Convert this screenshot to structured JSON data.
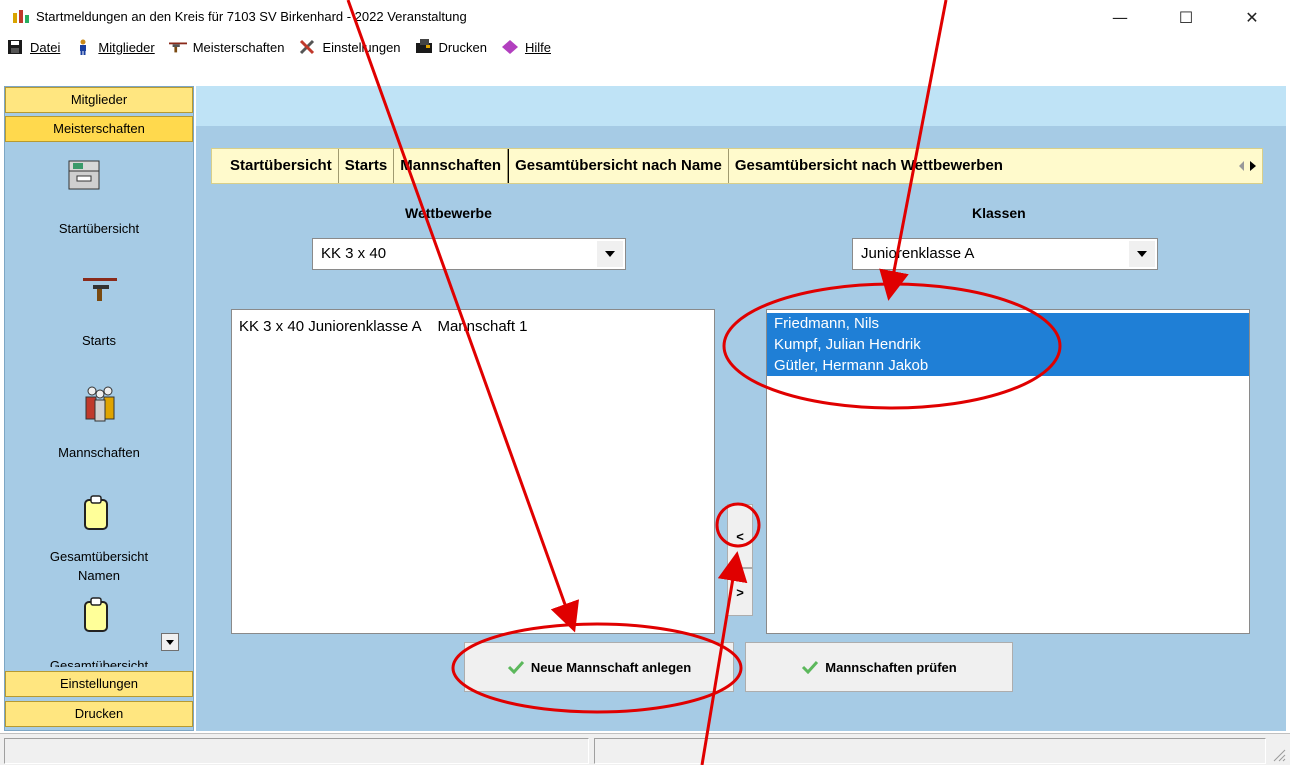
{
  "window": {
    "title": "Startmeldungen an den Kreis für 7103 SV Birkenhard - 2022  Veranstaltung",
    "minimize": "—",
    "maximize": "☐",
    "close": "✕"
  },
  "menu": [
    {
      "label": "Datei",
      "icon": "save-icon"
    },
    {
      "label": "Mitglieder",
      "icon": "member-icon"
    },
    {
      "label": "Meisterschaften",
      "icon": "rifle-icon"
    },
    {
      "label": "Einstellungen",
      "icon": "tools-icon"
    },
    {
      "label": "Drucken",
      "icon": "printer-icon"
    },
    {
      "label": "Hilfe",
      "icon": "help-icon"
    }
  ],
  "sidebar": {
    "headers": {
      "mitglieder": "Mitglieder",
      "meisterschaften": "Meisterschaften",
      "einstellungen": "Einstellungen",
      "drucken": "Drucken"
    },
    "items": [
      {
        "label": "Startübersicht",
        "icon": "overview-icon"
      },
      {
        "label": "Starts",
        "icon": "rifle-icon"
      },
      {
        "label": "Mannschaften",
        "icon": "team-icon"
      },
      {
        "label": "Gesamtübersicht\nNamen",
        "icon": "clipboard-icon"
      },
      {
        "label": "Gesamtübersicht",
        "icon": "clipboard-icon"
      }
    ]
  },
  "tabs": [
    "Startübersicht",
    "Starts",
    "Mannschaften",
    "Gesamtübersicht nach Name",
    "Gesamtübersicht nach Wettbewerben"
  ],
  "tabs_active": "Mannschaften",
  "wettbewerbe": {
    "label": "Wettbewerbe",
    "selected": "KK 3 x 40"
  },
  "klassen": {
    "label": "Klassen",
    "selected": "Juniorenklasse A"
  },
  "teams_list": [
    "KK 3 x 40 Juniorenklasse A    Mannschaft 1"
  ],
  "members_list": [
    {
      "name": "Friedmann, Nils",
      "selected": true
    },
    {
      "name": "Kumpf, Julian Hendrik",
      "selected": true
    },
    {
      "name": "Gütler, Hermann Jakob",
      "selected": true
    }
  ],
  "buttons": {
    "move_left": "<",
    "move_right": ">",
    "new_team": "Neue Mannschaft anlegen",
    "check_teams": "Mannschaften prüfen"
  },
  "colors": {
    "panel_bg": "#a6cbe5",
    "header_yellow": "#ffe680",
    "selection_blue": "#1f7fd6",
    "annotation_red": "#e00000"
  }
}
